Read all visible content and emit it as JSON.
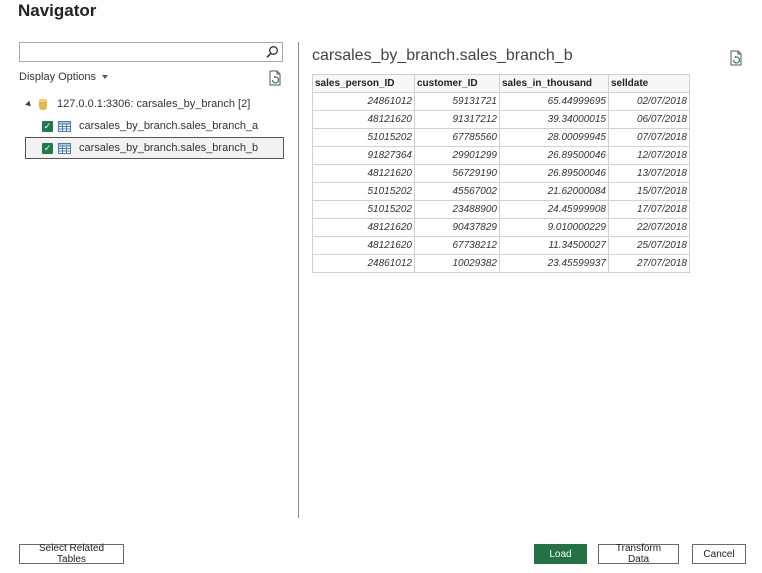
{
  "window": {
    "title": "Navigator"
  },
  "search": {
    "value": "",
    "placeholder": ""
  },
  "display_options": {
    "label": "Display Options"
  },
  "tree": {
    "server": {
      "label": "127.0.0.1:3306: carsales_by_branch [2]"
    },
    "items": [
      {
        "label": "carsales_by_branch.sales_branch_a",
        "checked": true
      },
      {
        "label": "carsales_by_branch.sales_branch_b",
        "checked": true
      }
    ]
  },
  "preview": {
    "title": "carsales_by_branch.sales_branch_b",
    "columns": [
      "sales_person_ID",
      "customer_ID",
      "sales_in_thousand",
      "selldate"
    ],
    "rows": [
      [
        "24861012",
        "59131721",
        "65.44999695",
        "02/07/2018"
      ],
      [
        "48121620",
        "91317212",
        "39.34000015",
        "06/07/2018"
      ],
      [
        "51015202",
        "67785560",
        "28.00099945",
        "07/07/2018"
      ],
      [
        "91827364",
        "29901299",
        "26.89500046",
        "12/07/2018"
      ],
      [
        "48121620",
        "56729190",
        "26.89500046",
        "13/07/2018"
      ],
      [
        "51015202",
        "45567002",
        "21.62000084",
        "15/07/2018"
      ],
      [
        "51015202",
        "23488900",
        "24.45999908",
        "17/07/2018"
      ],
      [
        "48121620",
        "90437829",
        "9.010000229",
        "22/07/2018"
      ],
      [
        "48121620",
        "67738212",
        "11.34500027",
        "25/07/2018"
      ],
      [
        "24861012",
        "10029382",
        "23.45599937",
        "27/07/2018"
      ]
    ]
  },
  "footer": {
    "select_related": "Select Related Tables",
    "load": "Load",
    "transform": "Transform Data",
    "cancel": "Cancel"
  },
  "icons": {
    "search": "search-icon",
    "refresh": "refresh-icon",
    "database": "database-icon",
    "table": "table-icon",
    "checkbox": "checkbox-checked-icon",
    "expander": "expander-icon"
  },
  "colors": {
    "accent": "#217346",
    "checkbox": "#1f7a4d",
    "database": "#e8b84a"
  }
}
